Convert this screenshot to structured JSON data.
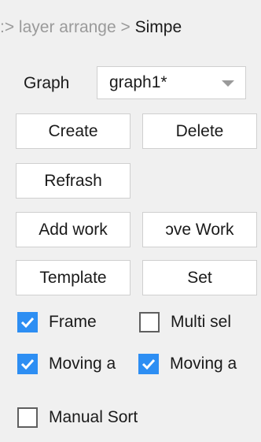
{
  "breadcrumb": {
    "prefix": ":> layer arrange > ",
    "current": "Simpe"
  },
  "graph": {
    "label": "Graph",
    "selected": "graph1*"
  },
  "buttons": {
    "create": "Create",
    "delete": "Delete",
    "refresh": "Refrash",
    "add_work": "Add work",
    "remove_work": "ɔve Work",
    "template": "Template",
    "set": "Set"
  },
  "checkboxes": {
    "frame": {
      "label": "Frame",
      "checked": true
    },
    "multi_sel": {
      "label": "Multi sel",
      "checked": false
    },
    "moving_1": {
      "label": "Moving a",
      "checked": true
    },
    "moving_2": {
      "label": "Moving a",
      "checked": true
    },
    "manual_sort": {
      "label": "Manual Sort",
      "checked": false
    }
  },
  "colors": {
    "checkbox_accent": "#2d8ef3",
    "breadcrumb_muted": "#9a9a9a"
  }
}
